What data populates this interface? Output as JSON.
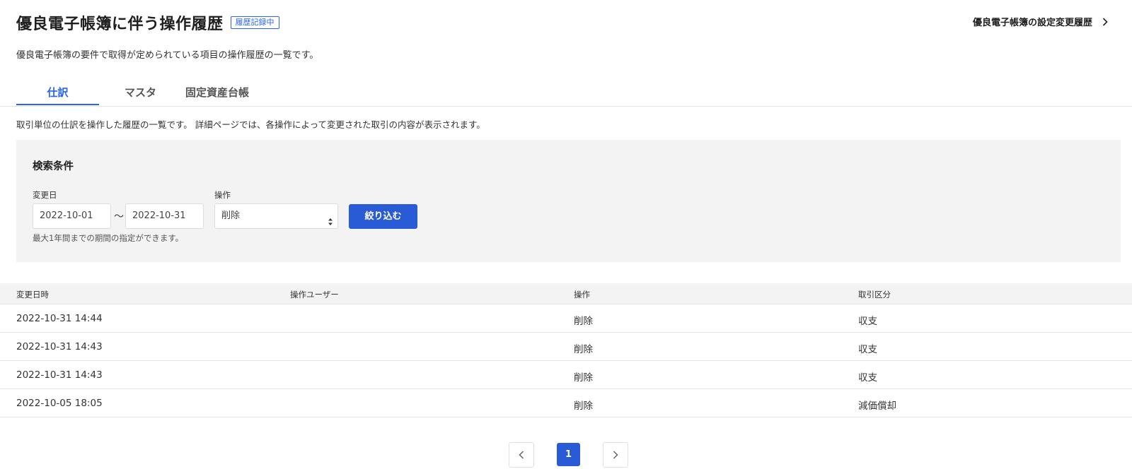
{
  "header": {
    "title": "優良電子帳簿に伴う操作履歴",
    "badge": "履歴記録中",
    "settings_link": "優良電子帳簿の設定変更履歴",
    "subtitle": "優良電子帳簿の要件で取得が定められている項目の操作履歴の一覧です。"
  },
  "tabs": [
    {
      "label": "仕訳",
      "active": true
    },
    {
      "label": "マスタ",
      "active": false
    },
    {
      "label": "固定資産台帳",
      "active": false
    }
  ],
  "description": "取引単位の仕訳を操作した履歴の一覧です。 詳細ページでは、各操作によって変更された取引の内容が表示されます。",
  "search": {
    "title": "検索条件",
    "date_label": "変更日",
    "date_from": "2022-10-01",
    "date_separator": "〜",
    "date_to": "2022-10-31",
    "operation_label": "操作",
    "operation_value": "削除",
    "filter_button": "絞り込む",
    "hint": "最大1年間までの期間の指定ができます。"
  },
  "table": {
    "headers": [
      "変更日時",
      "操作ユーザー",
      "操作",
      "取引区分"
    ],
    "rows": [
      [
        "2022-10-31 14:44",
        "",
        "削除",
        "収支"
      ],
      [
        "2022-10-31 14:43",
        "",
        "削除",
        "収支"
      ],
      [
        "2022-10-31 14:43",
        "",
        "削除",
        "収支"
      ],
      [
        "2022-10-05 18:05",
        "",
        "削除",
        "減価償却"
      ]
    ]
  },
  "pagination": {
    "current_page": "1",
    "prev_icon": "chevron-left-icon",
    "next_icon": "chevron-right-icon"
  },
  "colors": {
    "accent": "#2864f0",
    "button": "#2a5bd7",
    "panel_bg": "#f4f3f3"
  }
}
